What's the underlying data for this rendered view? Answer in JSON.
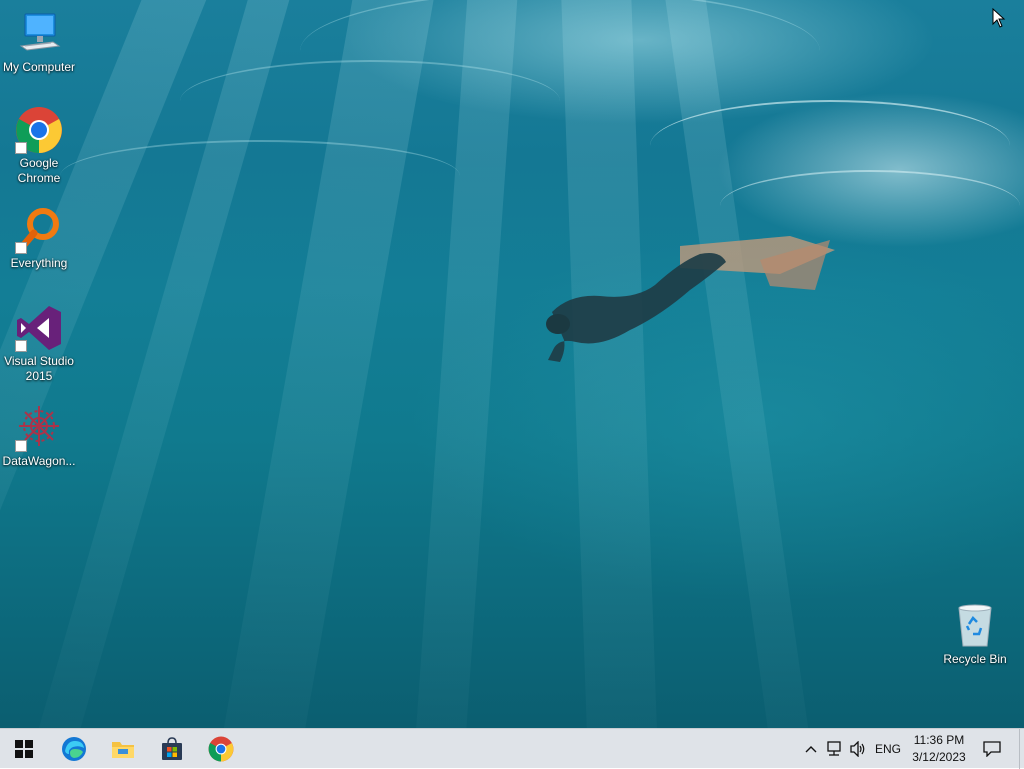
{
  "desktop": {
    "icons": [
      {
        "label": "My Computer",
        "icon": "computer-icon"
      },
      {
        "label": "Google Chrome",
        "icon": "chrome-icon",
        "shortcut": true
      },
      {
        "label": "Everything",
        "icon": "everything-search-icon",
        "shortcut": true
      },
      {
        "label": "Visual Studio 2015",
        "icon": "visual-studio-icon",
        "shortcut": true
      },
      {
        "label": "DataWagon...",
        "icon": "datawagon-icon",
        "shortcut": true
      }
    ],
    "recycle_bin": {
      "label": "Recycle Bin",
      "icon": "recycle-bin-icon"
    }
  },
  "taskbar": {
    "start": {
      "icon": "windows-start-icon"
    },
    "pinned": [
      {
        "name": "Microsoft Edge",
        "icon": "edge-icon"
      },
      {
        "name": "File Explorer",
        "icon": "file-explorer-icon"
      },
      {
        "name": "Microsoft Store",
        "icon": "store-icon"
      },
      {
        "name": "Google Chrome",
        "icon": "chrome-icon"
      }
    ],
    "tray": {
      "chevron_icon": "chevron-up-icon",
      "network_icon": "network-icon",
      "volume_icon": "volume-icon",
      "language": "ENG",
      "time": "11:36 PM",
      "date": "3/12/2023",
      "notification_icon": "action-center-icon"
    }
  },
  "colors": {
    "taskbar_bg": "#dfe3e8",
    "water_top": "#1a7f9c",
    "water_bottom": "#0b5e70"
  }
}
